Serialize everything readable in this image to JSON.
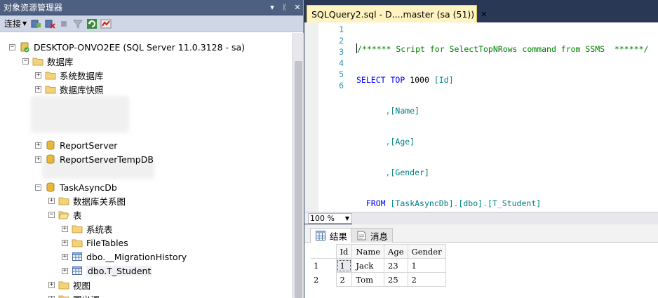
{
  "object_explorer": {
    "title": "对象资源管理器",
    "title_buttons": [
      "▾",
      "ᛕ",
      "✕"
    ],
    "toolbar": {
      "connect_label": "连接"
    },
    "tree": [
      {
        "label": "DESKTOP-ONVO2EE (SQL Server 11.0.3128 - sa)",
        "expander": "−",
        "icon": "server-icon"
      },
      {
        "label": "数据库",
        "expander": "−",
        "icon": "folder-icon"
      },
      {
        "label": "系统数据库",
        "expander": "+",
        "icon": "folder-icon"
      },
      {
        "label": "数据库快照",
        "expander": "+",
        "icon": "folder-icon"
      },
      {
        "label": "ReportServer",
        "expander": "+",
        "icon": "database-icon"
      },
      {
        "label": "ReportServerTempDB",
        "expander": "+",
        "icon": "database-icon"
      },
      {
        "label": "TaskAsyncDb",
        "expander": "−",
        "icon": "database-icon"
      },
      {
        "label": "数据库关系图",
        "expander": "+",
        "icon": "folder-icon"
      },
      {
        "label": "表",
        "expander": "−",
        "icon": "folder-icon"
      },
      {
        "label": "系统表",
        "expander": "+",
        "icon": "folder-icon"
      },
      {
        "label": "FileTables",
        "expander": "+",
        "icon": "folder-icon"
      },
      {
        "label": "dbo.__MigrationHistory",
        "expander": "+",
        "icon": "table-icon"
      },
      {
        "label": "dbo.T_Student",
        "expander": "+",
        "icon": "table-icon"
      },
      {
        "label": "视图",
        "expander": "+",
        "icon": "folder-icon"
      },
      {
        "label": "同义词",
        "expander": "+",
        "icon": "folder-icon"
      }
    ]
  },
  "editor": {
    "tab_label": "SQLQuery2.sql - D....master (sa (51))",
    "line_numbers": [
      "1",
      "2",
      "3",
      "4",
      "5",
      "6"
    ],
    "code": {
      "l1_comment": "/****** Script for SelectTopNRows command from SSMS  ******/",
      "l2_kw1": "SELECT",
      "l2_kw2": "TOP",
      "l2_num": "1000",
      "l2_col": "[Id]",
      "l3_col": "[Name]",
      "l4_col": "[Age]",
      "l5_col": "[Gender]",
      "l6_kw": "FROM",
      "l6_db": "[TaskAsyncDb]",
      "l6_schema": "[dbo]",
      "l6_table": "[T_Student]",
      "comma": ",",
      "dot": "."
    },
    "zoom": "100 %"
  },
  "results": {
    "tabs": {
      "results_label": "结果",
      "messages_label": "消息"
    },
    "columns": [
      "Id",
      "Name",
      "Age",
      "Gender"
    ],
    "rows": [
      {
        "row_number": "1",
        "cells": [
          "1",
          "Jack",
          "23",
          "1"
        ]
      },
      {
        "row_number": "2",
        "cells": [
          "2",
          "Tom",
          "25",
          "2"
        ]
      }
    ]
  },
  "colors": {
    "title_bar": "#4d6082",
    "tab_active": "#fff3bf",
    "keyword": "#0000ff",
    "comment": "#008000",
    "line_number": "#2b91af"
  }
}
